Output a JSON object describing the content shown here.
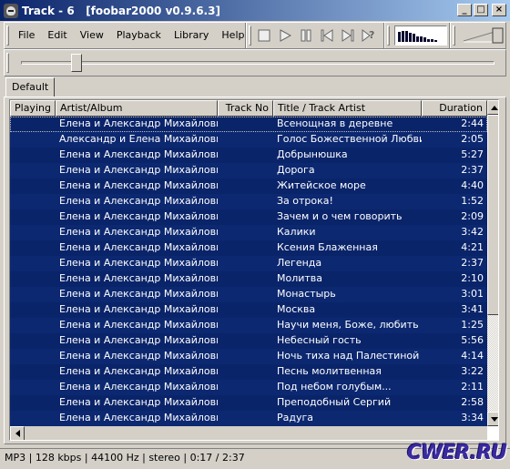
{
  "window": {
    "title": "Track - 6   [foobar2000 v0.9.6.3]",
    "minimize_label": "_",
    "maximize_label": "□",
    "close_label": "×"
  },
  "menu": [
    "File",
    "Edit",
    "View",
    "Playback",
    "Library",
    "Help"
  ],
  "transport": [
    {
      "name": "stop",
      "icon": "stop-icon"
    },
    {
      "name": "play",
      "icon": "play-icon"
    },
    {
      "name": "pause",
      "icon": "pause-icon"
    },
    {
      "name": "previous",
      "icon": "previous-icon"
    },
    {
      "name": "next",
      "icon": "next-icon"
    },
    {
      "name": "random",
      "icon": "random-icon"
    }
  ],
  "visualizer_levels": [
    0.7,
    0.75,
    0.75,
    0.65,
    0.55,
    0.4,
    0.4,
    0.3,
    0.2,
    0.2,
    0.1
  ],
  "volume_level": 1.0,
  "seek_position": 0.108,
  "tabs": [
    "Default"
  ],
  "playlist": {
    "columns": [
      "Playing",
      "Artist/Album",
      "Track No",
      "Title / Track Artist",
      "Duration"
    ],
    "rows": [
      {
        "artist": "Елена и Александр Михайловы...",
        "track": "",
        "title": "Всенощная в деревне",
        "duration": "2:44"
      },
      {
        "artist": "Александр и Елена Михайловы...",
        "track": "",
        "title": "Голос Божественной Любви",
        "duration": "2:05"
      },
      {
        "artist": "Елена и Александр Михайловы...",
        "track": "",
        "title": "Добрынюшка",
        "duration": "5:27"
      },
      {
        "artist": "Елена и Александр Михайловы...",
        "track": "",
        "title": "Дорога",
        "duration": "2:37"
      },
      {
        "artist": "Елена и Александр Михайловы...",
        "track": "",
        "title": "Житейское море",
        "duration": "4:40"
      },
      {
        "artist": "Елена и Александр Михайловы...",
        "track": "",
        "title": "За отрока!",
        "duration": "1:52"
      },
      {
        "artist": "Елена и Александр Михайловы...",
        "track": "",
        "title": "Зачем и о чем говорить",
        "duration": "2:09"
      },
      {
        "artist": "Елена и Александр Михайловы...",
        "track": "",
        "title": "Калики",
        "duration": "3:42"
      },
      {
        "artist": "Елена и Александр Михайловы...",
        "track": "",
        "title": "Ксения Блаженная",
        "duration": "4:21"
      },
      {
        "artist": "Елена и Александр Михайловы...",
        "track": "",
        "title": "Легенда",
        "duration": "2:37"
      },
      {
        "artist": "Елена и Александр Михайловы...",
        "track": "",
        "title": "Молитва",
        "duration": "2:10"
      },
      {
        "artist": "Елена и Александр Михайловы...",
        "track": "",
        "title": "Монастырь",
        "duration": "3:01"
      },
      {
        "artist": "Елена и Александр Михайловы...",
        "track": "",
        "title": "Москва",
        "duration": "3:41"
      },
      {
        "artist": "Елена и Александр Михайловы...",
        "track": "",
        "title": "Научи меня, Боже, любить",
        "duration": "1:25"
      },
      {
        "artist": "Елена и Александр Михайловы...",
        "track": "",
        "title": "Небесный гость",
        "duration": "5:56"
      },
      {
        "artist": "Елена и Александр Михайловы...",
        "track": "",
        "title": "Ночь тиха над Палестиной",
        "duration": "4:14"
      },
      {
        "artist": "Елена и Александр Михайловы...",
        "track": "",
        "title": "Песнь молитвенная",
        "duration": "3:22"
      },
      {
        "artist": "Елена и Александр Михайловы...",
        "track": "",
        "title": "Под небом голубым...",
        "duration": "2:11"
      },
      {
        "artist": "Елена и Александр Михайловы...",
        "track": "",
        "title": "Преподобный Сергий",
        "duration": "2:58"
      },
      {
        "artist": "Елена и Александр Михайловы...",
        "track": "",
        "title": "Радуга",
        "duration": "3:34"
      }
    ]
  },
  "status": "MP3 | 128 kbps | 44100 Hz | stereo | 0:17 / 2:37",
  "watermark": "CWER.RU",
  "colors": {
    "selection": "#0a246a",
    "face": "#d4d0c8"
  }
}
